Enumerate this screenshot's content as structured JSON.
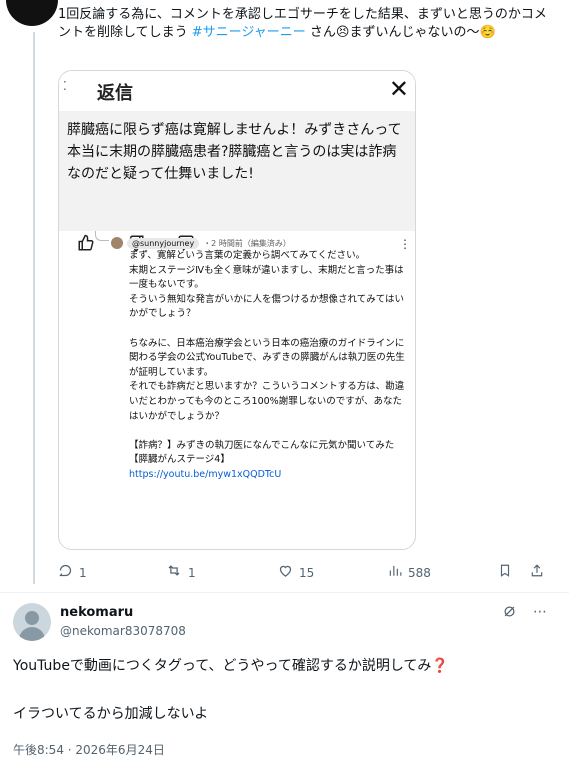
{
  "tweet": {
    "text_part1": "1回反論する為に、コメントを承認しエゴサーチをした結果、まずいと思うのかコメントを削除してしまう ",
    "hashtag": "#サニージャーニー",
    "text_part2": " さん",
    "emoji1": "😣",
    "text_part3": "まずいんじゃないの〜",
    "emoji2": "☺️"
  },
  "reply_dialog": {
    "title": "返信",
    "close_icon": "close-icon",
    "quoted_text": "膵臓癌に限らず癌は寛解しませんよ！みずきさんって本当に末期の膵臓癌患者?膵臓癌と言うのは実は詐病なのだと疑って仕舞いました!",
    "actions": [
      "thumbs-up-icon",
      "thumbs-down-icon",
      "comment-icon"
    ]
  },
  "yt_reply": {
    "handle": "@sunnyjourney",
    "meta": "・2 時間前（編集済み）",
    "text": "まず、寛解という言葉の定義から調べてみてください。\n末期とステージⅣも全く意味が違いますし、末期だと言った事は一度もないです。\nそういう無知な発言がいかに人を傷つけるか想像されてみてはいかがでしょう？\n\nちなみに、日本癌治療学会という日本の癌治療のガイドラインに関わる学会の公式YouTubeで、みずきの膵臓がんは執刀医の先生が証明しています。\nそれでも詐病だと思いますか？こういうコメントする方は、勘違いだとわかっても今のところ100%謝罪しないのですが、あなたはいかがでしょうか？\n\n【詐病？】みずきの執刀医になんでこんなに元気か聞いてみた【膵臓がんステージ4】",
    "link": "https://youtu.be/myw1xQQDTcU"
  },
  "stats": {
    "replies": "1",
    "retweets": "1",
    "likes": "15",
    "views": "588"
  },
  "reply": {
    "name": "nekomaru",
    "handle": "@nekomar83078708",
    "line1": "YouTubeで動画につくタグって、どうやって確認するか説明してみ",
    "line1_mark": "❓",
    "line2": "イラついてるから加減しないよ",
    "timestamp": "午後8:54 · 2026年6月24日"
  },
  "colors": {
    "hashtag": "#1d9bf0",
    "muted": "#536471",
    "link": "#065fd4"
  }
}
